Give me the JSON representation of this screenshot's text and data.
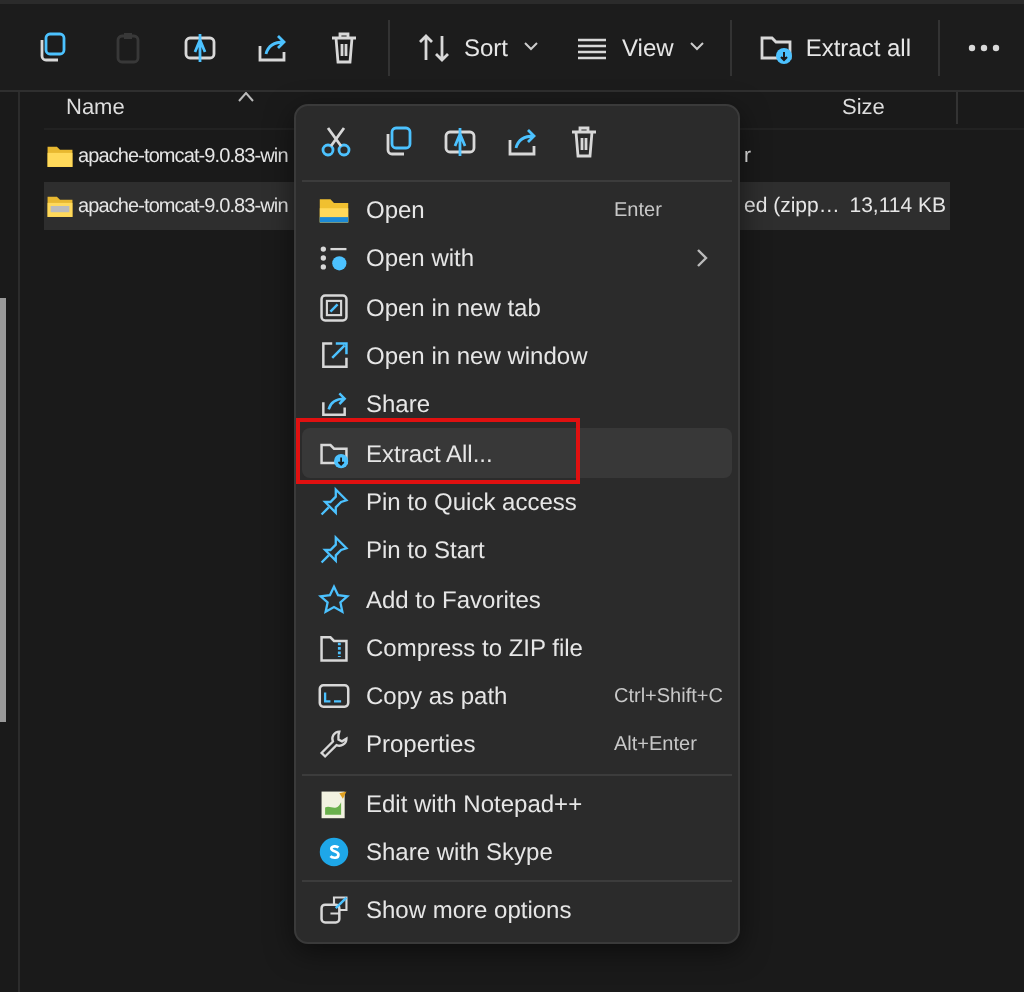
{
  "toolbar": [
    {
      "kind": "copy",
      "disabled": false
    },
    {
      "kind": "paste",
      "disabled": true
    },
    {
      "kind": "rename",
      "disabled": false
    },
    {
      "kind": "share",
      "disabled": false
    },
    {
      "kind": "delete",
      "disabled": false
    },
    {
      "kind": "sort",
      "label": "Sort",
      "dropdown": true,
      "disabled": false
    },
    {
      "kind": "view",
      "label": "View",
      "dropdown": true,
      "disabled": false
    },
    {
      "kind": "extract",
      "label": "Extract all",
      "disabled": false
    },
    {
      "kind": "more",
      "disabled": false
    }
  ],
  "table": {
    "columns": [
      {
        "label": "Name",
        "sorted": true
      },
      {
        "label": "Size",
        "sorted": false
      }
    ],
    "rows": [
      {
        "kind": "folder",
        "name": "apache-tomcat-9.0.83-win",
        "type": "r",
        "selected": false
      },
      {
        "kind": "zip",
        "name": "apache-tomcat-9.0.83-win",
        "type": "ed (zipp…",
        "size": "13,114 KB",
        "selected": true
      }
    ]
  },
  "context_menu": {
    "quick_actions": [
      {
        "kind": "cut"
      },
      {
        "kind": "copy"
      },
      {
        "kind": "rename"
      },
      {
        "kind": "share"
      },
      {
        "kind": "delete"
      }
    ],
    "groups": [
      [
        {
          "kind": "folder",
          "label": "Open",
          "shortcut": "Enter",
          "selected": false,
          "outlined": false
        },
        {
          "kind": "open-with",
          "label": "Open with",
          "submenu": true,
          "selected": false,
          "outlined": false
        },
        {
          "kind": "new-tab",
          "label": "Open in new tab",
          "selected": false,
          "outlined": false
        },
        {
          "kind": "new-window",
          "label": "Open in new window",
          "selected": false,
          "outlined": false
        },
        {
          "kind": "share",
          "label": "Share",
          "selected": false,
          "outlined": false
        },
        {
          "kind": "extract",
          "label": "Extract All...",
          "selected": true,
          "outlined": true
        },
        {
          "kind": "pin",
          "label": "Pin to Quick access",
          "selected": false,
          "outlined": false
        },
        {
          "kind": "pin",
          "label": "Pin to Start",
          "selected": false,
          "outlined": false
        },
        {
          "kind": "star",
          "label": "Add to Favorites",
          "selected": false,
          "outlined": false
        },
        {
          "kind": "zip",
          "label": "Compress to ZIP file",
          "selected": false,
          "outlined": false
        },
        {
          "kind": "path",
          "label": "Copy as path",
          "shortcut": "Ctrl+Shift+C",
          "selected": false,
          "outlined": false
        },
        {
          "kind": "wrench",
          "label": "Properties",
          "shortcut": "Alt+Enter",
          "selected": false,
          "outlined": false
        }
      ],
      [
        {
          "kind": "notepad",
          "label": "Edit with Notepad++",
          "selected": false,
          "outlined": false
        },
        {
          "kind": "skype",
          "label": "Share with Skype",
          "selected": false,
          "outlined": false
        }
      ],
      [
        {
          "kind": "more-options",
          "label": "Show more options",
          "selected": false,
          "outlined": false
        }
      ]
    ]
  }
}
